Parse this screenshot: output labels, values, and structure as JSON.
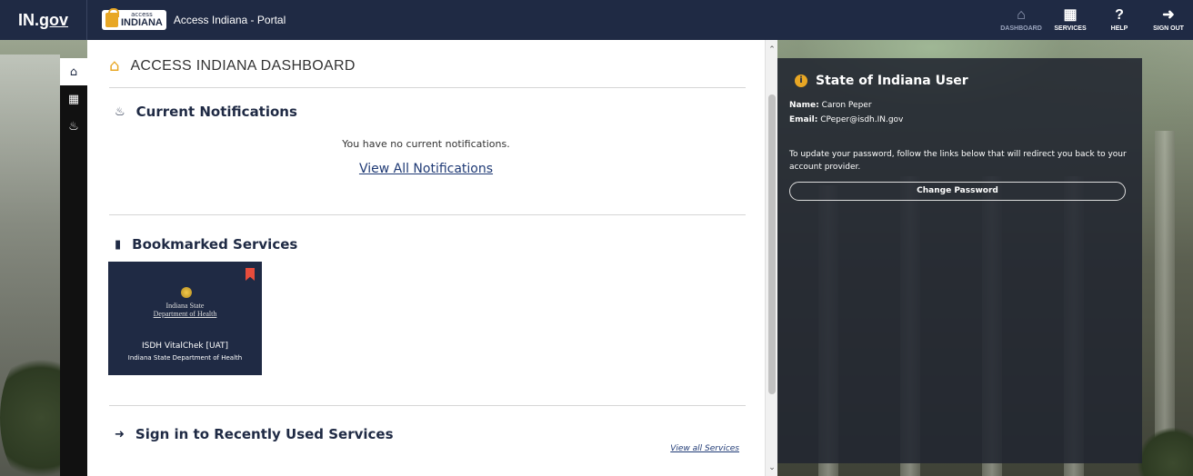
{
  "topbar": {
    "brand": "IN.gov",
    "brand_prefix": "IN.",
    "brand_suffix": "gov",
    "logo_small": "access",
    "logo_big": "INDIANA",
    "portal_title": "Access Indiana - Portal",
    "nav": [
      {
        "label": "DASHBOARD",
        "icon": "home-icon"
      },
      {
        "label": "SERVICES",
        "icon": "grid-icon"
      },
      {
        "label": "HELP",
        "icon": "question-icon"
      },
      {
        "label": "SIGN OUT",
        "icon": "sign-out-icon"
      }
    ]
  },
  "rail": [
    {
      "icon": "home-icon"
    },
    {
      "icon": "grid-icon"
    },
    {
      "icon": "bell-icon"
    }
  ],
  "main": {
    "title": "ACCESS INDIANA DASHBOARD",
    "notifications": {
      "title": "Current Notifications",
      "empty_text": "You have no current notifications.",
      "view_all": "View All Notifications"
    },
    "bookmarks": {
      "title": "Bookmarked Services",
      "card": {
        "org_line1": "Indiana State",
        "org_line2": "Department of Health",
        "name": "ISDH VitalChek [UAT]",
        "dept": "Indiana State Department of Health"
      }
    },
    "recent": {
      "title": "Sign in to Recently Used Services",
      "view_all": "View all Services"
    }
  },
  "user_panel": {
    "title": "State of Indiana User",
    "name_label": "Name:",
    "name_value": "Caron Peper",
    "email_label": "Email:",
    "email_value": "CPeper@isdh.IN.gov",
    "message": "To update your password, follow the links below that will redirect you back to your account provider.",
    "change_password": "Change Password"
  },
  "colors": {
    "navy": "#1f2a44",
    "accent": "#e8a724",
    "bookmark": "#e74c3c"
  }
}
